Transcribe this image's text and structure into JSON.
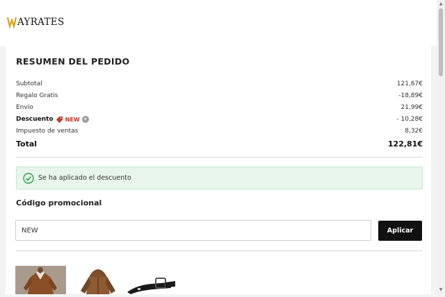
{
  "brand": {
    "logo_text": "AYRATES",
    "logo_mark": "W-logo",
    "accent_color": "#d9a21b"
  },
  "summary": {
    "title": "RESUMEN DEL PEDIDO",
    "rows": [
      {
        "label": "Subtotal",
        "value": "121,67€"
      },
      {
        "label": "Regalo Gratis",
        "value": "-18,89€"
      },
      {
        "label": "Envío",
        "value": "21,99€"
      },
      {
        "label": "Descuento",
        "code": "NEW",
        "value": "- 10,28€"
      },
      {
        "label": "Impuesto de ventas",
        "value": "8,32€"
      }
    ],
    "total": {
      "label": "Total",
      "value": "122,81€"
    }
  },
  "alert": {
    "icon": "check-circle-icon",
    "text": "Se ha aplicado el descuento",
    "color": "#2e9e4a"
  },
  "promo": {
    "label": "Código promocional",
    "value": "NEW",
    "apply_label": "Aplicar"
  },
  "products": [
    {
      "name": "brown-shearling-jacket-thumbnail"
    },
    {
      "name": "brown-hooded-jacket-thumbnail"
    },
    {
      "name": "black-belt-thumbnail"
    }
  ]
}
